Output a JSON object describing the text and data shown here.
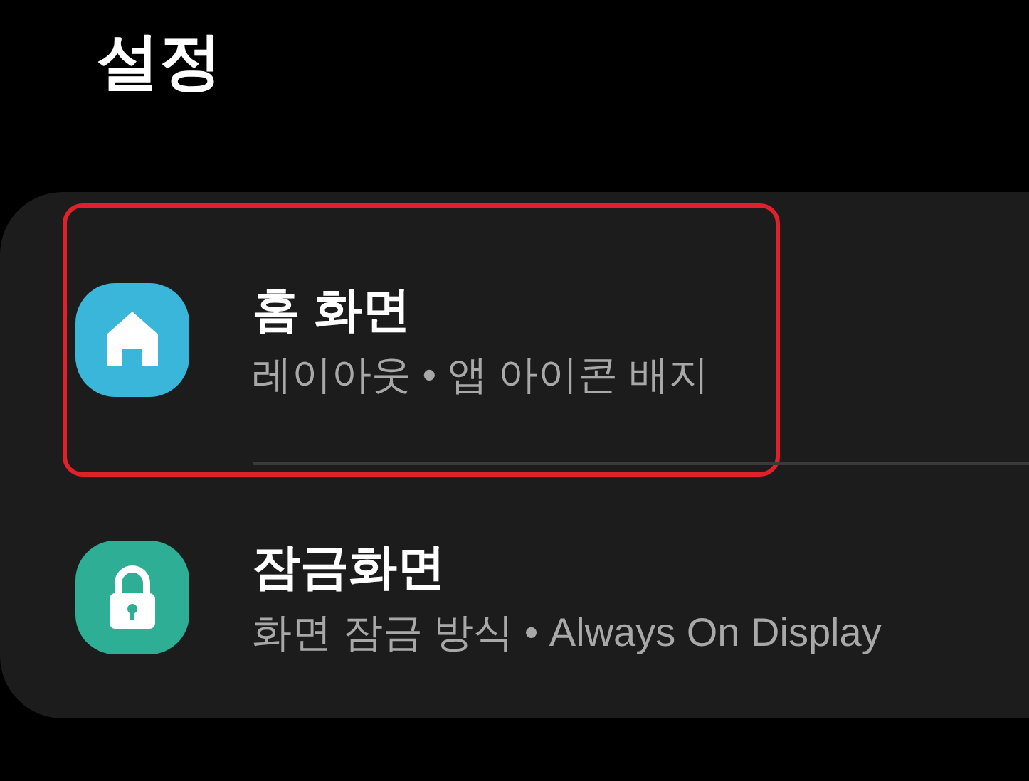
{
  "title": "설정",
  "items": [
    {
      "title": "홈 화면",
      "subtitle": "레이아웃 • 앱 아이콘 배지",
      "kind": "home",
      "color": "#3ab6da",
      "highlighted": true
    },
    {
      "title": "잠금화면",
      "subtitle": "화면 잠금 방식 • Always On Display",
      "kind": "lock",
      "color": "#2eae94",
      "highlighted": false
    }
  ]
}
